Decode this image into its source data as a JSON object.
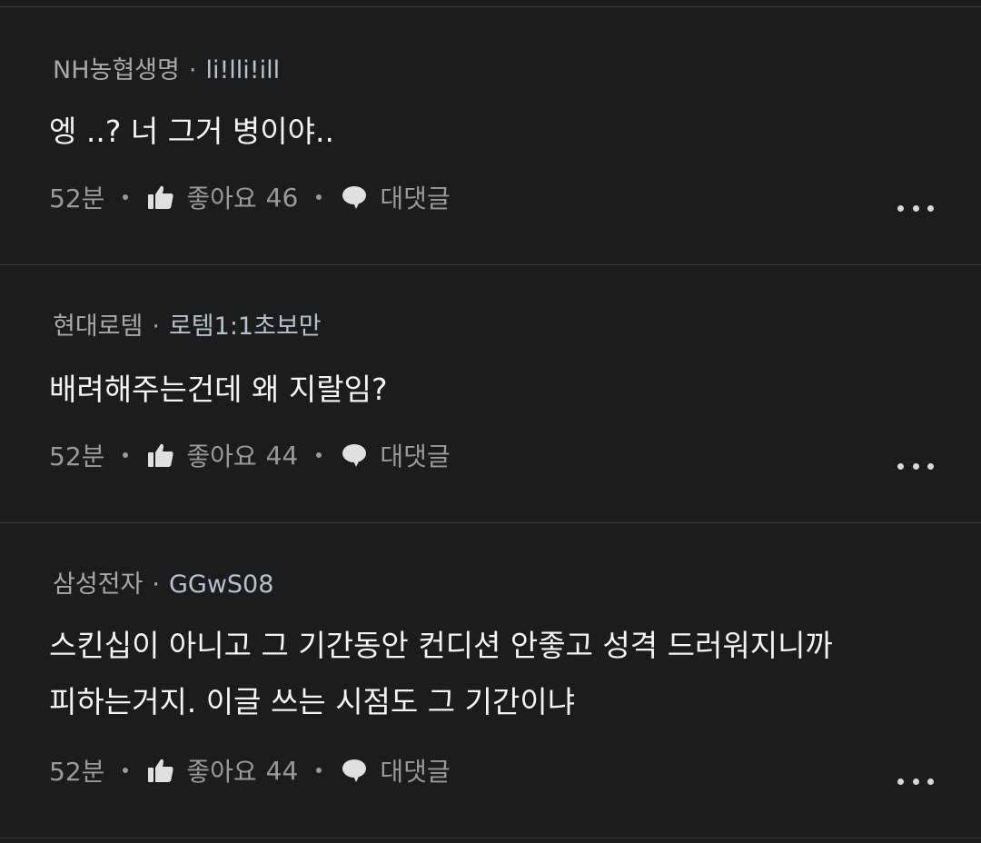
{
  "comments": [
    {
      "company": "NH농협생명",
      "nickname": "li!lli!ill",
      "text_lines": [
        "엥 ..? 너 그거 병이야.."
      ],
      "time": "52분",
      "like_label": "좋아요",
      "like_count": "46",
      "reply_label": "대댓글"
    },
    {
      "company": "현대로템",
      "nickname": "로템1:1초보만",
      "text_lines": [
        "배려해주는건데 왜 지랄임?"
      ],
      "time": "52분",
      "like_label": "좋아요",
      "like_count": "44",
      "reply_label": "대댓글"
    },
    {
      "company": "삼성전자",
      "nickname": "GGwS08",
      "text_lines": [
        "스킨십이 아니고 그 기간동안 컨디션 안좋고 성격 드러워지니까",
        "피하는거지. 이글 쓰는 시점도 그 기간이냐"
      ],
      "time": "52분",
      "like_label": "좋아요",
      "like_count": "44",
      "reply_label": "대댓글"
    }
  ],
  "separator": "·",
  "icons": {
    "like": "thumbs-up-icon",
    "reply": "speech-bubble-icon",
    "more": "more-dots-icon"
  },
  "colors": {
    "background": "#1c1c1c",
    "divider": "#3a3a3a",
    "text": "#f4f4f4",
    "meta": "#9a9a9a",
    "nickname": "#b8c0cc"
  }
}
